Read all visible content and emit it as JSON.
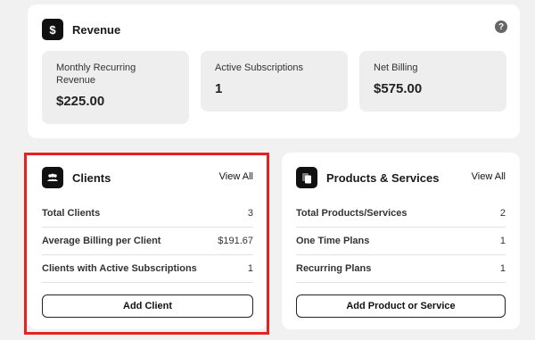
{
  "revenue": {
    "title": "Revenue",
    "icon": "dollar-icon",
    "help_icon": "help-icon",
    "metrics": [
      {
        "label": "Monthly Recurring Revenue",
        "value": "$225.00"
      },
      {
        "label": "Active Subscriptions",
        "value": "1"
      },
      {
        "label": "Net Billing",
        "value": "$575.00"
      }
    ]
  },
  "clients": {
    "title": "Clients",
    "icon": "users-icon",
    "view_all": "View All",
    "rows": [
      {
        "label": "Total Clients",
        "value": "3"
      },
      {
        "label": "Average Billing per Client",
        "value": "$191.67"
      },
      {
        "label": "Clients with Active Subscriptions",
        "value": "1"
      }
    ],
    "button": "Add Client"
  },
  "products": {
    "title": "Products & Services",
    "icon": "copy-icon",
    "view_all": "View All",
    "rows": [
      {
        "label": "Total Products/Services",
        "value": "2"
      },
      {
        "label": "One Time Plans",
        "value": "1"
      },
      {
        "label": "Recurring Plans",
        "value": "1"
      }
    ],
    "button": "Add Product or Service"
  },
  "colors": {
    "highlight": "#e52222",
    "icon_bg": "#111111",
    "card_bg": "#ffffff",
    "page_bg": "#f1f1f1",
    "metric_bg": "#eeeeee"
  }
}
